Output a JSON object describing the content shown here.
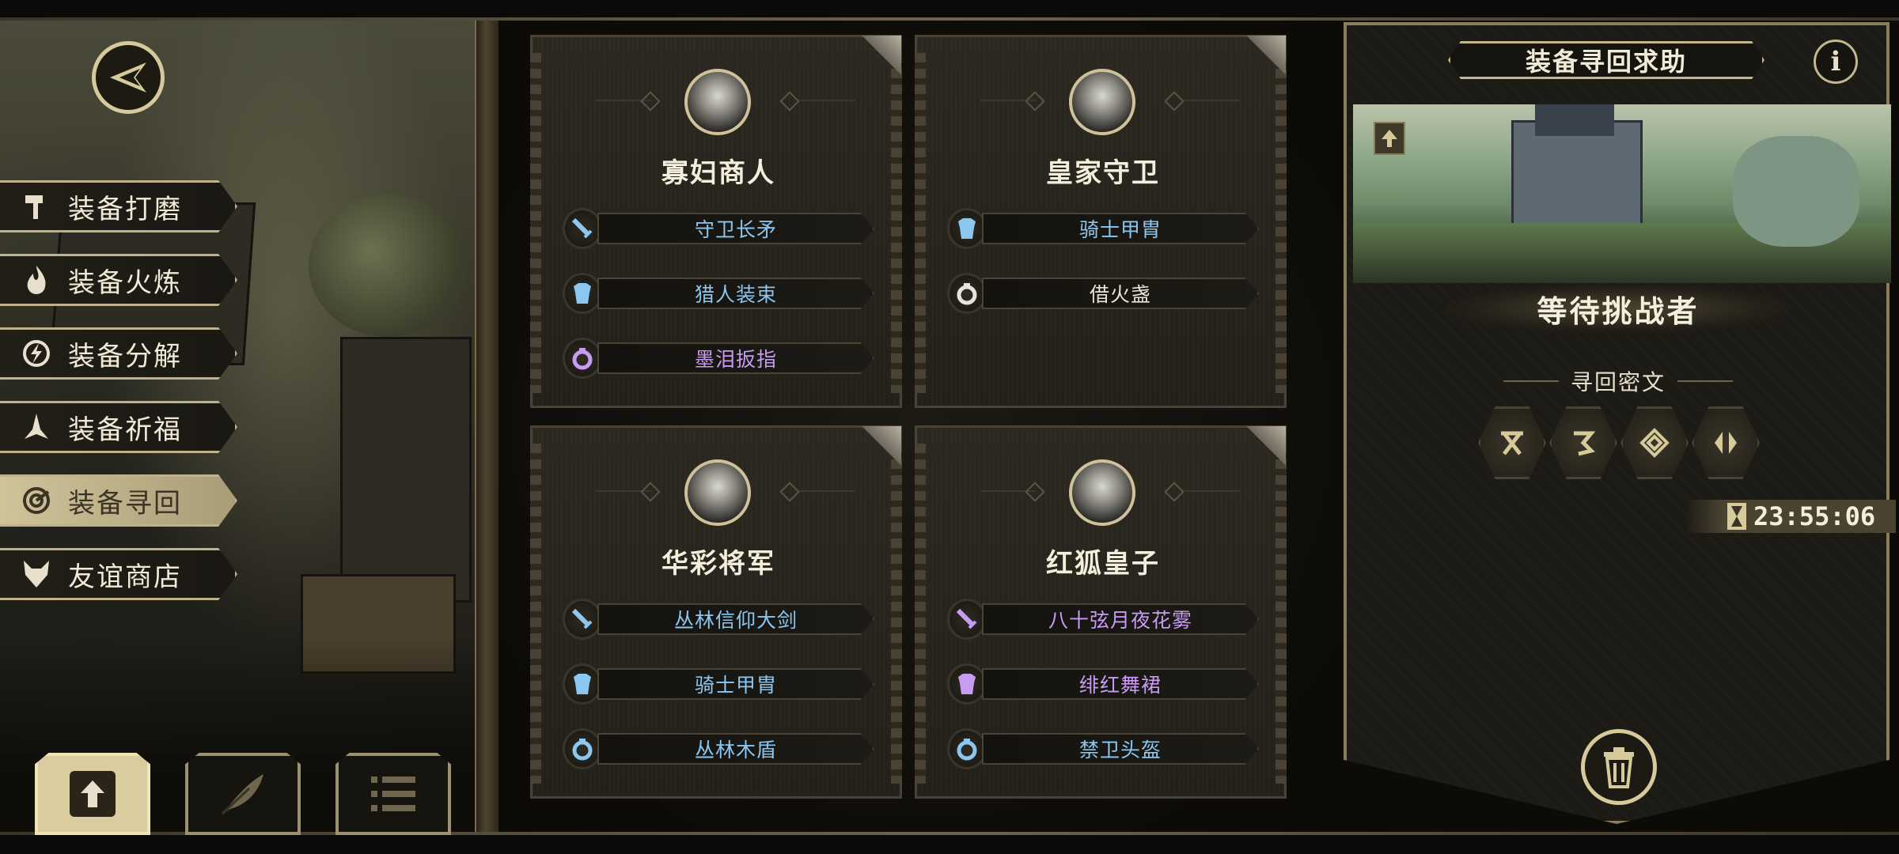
{
  "nav": {
    "back_icon": "back-arrow-icon",
    "menu": [
      {
        "label": "装备打磨",
        "icon": "hammer-icon",
        "active": false
      },
      {
        "label": "装备火炼",
        "icon": "flame-icon",
        "active": false
      },
      {
        "label": "装备分解",
        "icon": "decompose-icon",
        "active": false
      },
      {
        "label": "装备祈福",
        "icon": "pray-icon",
        "active": false
      },
      {
        "label": "装备寻回",
        "icon": "retrieve-icon",
        "active": true
      },
      {
        "label": "友谊商店",
        "icon": "fox-icon",
        "active": false
      }
    ],
    "bottom_tabs": [
      {
        "icon": "upload-icon",
        "active": true
      },
      {
        "icon": "feather-icon",
        "active": false
      },
      {
        "icon": "list-icon",
        "active": false
      }
    ]
  },
  "cards": [
    {
      "name": "寡妇商人",
      "items": [
        {
          "label": "守卫长矛",
          "type": "weapon",
          "rarity": "blue"
        },
        {
          "label": "猎人装束",
          "type": "armor",
          "rarity": "blue"
        },
        {
          "label": "墨泪扳指",
          "type": "ring",
          "rarity": "purple"
        }
      ]
    },
    {
      "name": "皇家守卫",
      "items": [
        {
          "label": "骑士甲胄",
          "type": "armor",
          "rarity": "blue"
        },
        {
          "label": "借火盏",
          "type": "ring",
          "rarity": "white"
        }
      ]
    },
    {
      "name": "华彩将军",
      "items": [
        {
          "label": "丛林信仰大剑",
          "type": "weapon",
          "rarity": "blue"
        },
        {
          "label": "骑士甲胄",
          "type": "armor",
          "rarity": "blue"
        },
        {
          "label": "丛林木盾",
          "type": "ring",
          "rarity": "blue"
        }
      ]
    },
    {
      "name": "红狐皇子",
      "items": [
        {
          "label": "八十弦月夜花雾",
          "type": "weapon",
          "rarity": "purple"
        },
        {
          "label": "绯红舞裙",
          "type": "armor",
          "rarity": "purple"
        },
        {
          "label": "禁卫头盔",
          "type": "ring",
          "rarity": "blue"
        }
      ]
    }
  ],
  "panel": {
    "title": "装备寻回求助",
    "info_label": "i",
    "status": "等待挑战者",
    "runes_heading": "寻回密文",
    "runes": [
      "rune-x-icon",
      "rune-hook-icon",
      "rune-diamond-icon",
      "rune-split-icon"
    ],
    "timer": "23:55:06"
  },
  "colors": {
    "blue": "#8cc7f0",
    "purple": "#c79cf2",
    "white": "#e8e4da",
    "gold": "#d6c99a"
  }
}
